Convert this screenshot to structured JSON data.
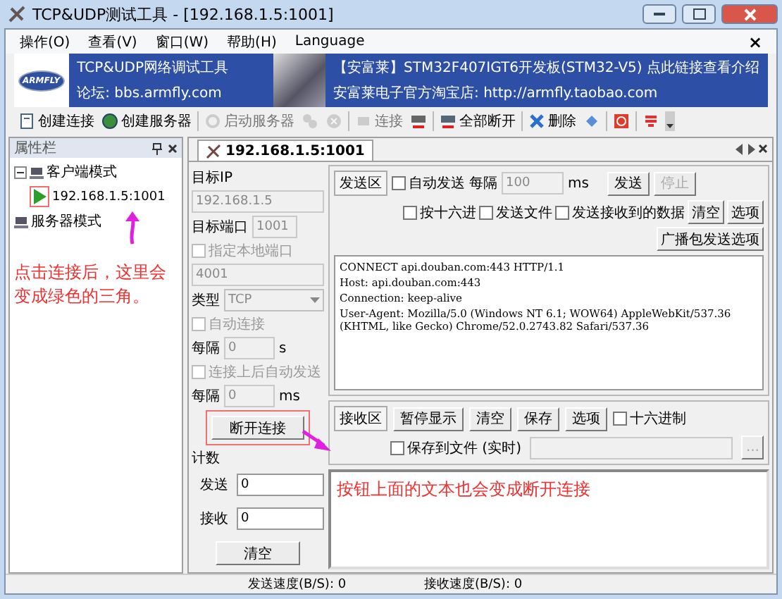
{
  "window": {
    "title": "TCP&UDP测试工具 - [192.168.1.5:1001]"
  },
  "menu": {
    "items": [
      "操作(O)",
      "查看(V)",
      "窗口(W)",
      "帮助(H)",
      "Language"
    ],
    "close": "×"
  },
  "banner": {
    "logo": "ARMFLY",
    "title": "TCP&UDP网络调试工具",
    "forum": "论坛: bbs.armfly.com",
    "product": "【安富莱】STM32F407IGT6开发板(STM32-V5) 点此链接查看介绍",
    "shop": "安富莱电子官方淘宝店: http://armfly.taobao.com"
  },
  "toolbar": [
    {
      "kind": "labeled",
      "label": "创建连接",
      "disabled": false
    },
    {
      "kind": "labeled",
      "label": "创建服务器",
      "disabled": false
    },
    {
      "kind": "separator"
    },
    {
      "kind": "labeled",
      "label": "启动服务器",
      "disabled": true
    },
    {
      "kind": "icon",
      "disabled": true
    },
    {
      "kind": "icon",
      "disabled": true
    },
    {
      "kind": "separator"
    },
    {
      "kind": "labeled",
      "label": "连接",
      "disabled": true
    },
    {
      "kind": "icon",
      "disabled": false
    },
    {
      "kind": "separator"
    },
    {
      "kind": "labeled",
      "label": "全部断开",
      "disabled": false
    },
    {
      "kind": "separator"
    },
    {
      "kind": "labeled",
      "label": "删除",
      "disabled": false
    },
    {
      "kind": "icon",
      "disabled": false
    },
    {
      "kind": "separator"
    },
    {
      "kind": "icon",
      "disabled": false
    },
    {
      "kind": "separator"
    },
    {
      "kind": "icon",
      "disabled": false
    }
  ],
  "sidebar": {
    "title": "属性栏",
    "tree": [
      {
        "label": "客户端模式",
        "expanded": true,
        "children": [
          {
            "label": "192.168.1.5:1001",
            "connected": true,
            "highlighted": true
          }
        ]
      },
      {
        "label": "服务器模式"
      }
    ],
    "note": "点击连接后，这里会变成绿色的三角。"
  },
  "tabs": [
    {
      "label": "192.168.1.5:1001",
      "selected": true
    }
  ],
  "config": {
    "ip_label": "目标IP",
    "ip": "192.168.1.5",
    "port_label": "目标端口",
    "port": "1001",
    "local_port": {
      "label": "指定本地端口",
      "checked": false
    },
    "local_port_value": "4001",
    "type_label": "类型",
    "type": "TCP",
    "auto_connect": {
      "label": "自动连接",
      "checked": false
    },
    "interval1": {
      "label": "每隔",
      "value": "0",
      "unit": "s"
    },
    "auto_send": {
      "label": "连接上后自动发送",
      "checked": false
    },
    "interval2": {
      "label": "每隔",
      "value": "0",
      "unit": "ms"
    },
    "connect_button": {
      "label": "断开连接",
      "highlighted": true
    }
  },
  "counter": {
    "title": "计数",
    "sent_label": "发送",
    "sent": "0",
    "received_label": "接收",
    "received": "0",
    "clear": "清空"
  },
  "send": {
    "title": "发送区",
    "auto_send": {
      "label": "自动发送",
      "checked": false
    },
    "interval_label": "每隔",
    "interval": "100",
    "unit": "ms",
    "send": {
      "label": "发送",
      "disabled": false
    },
    "stop": {
      "label": "停止",
      "disabled": true
    },
    "options": [
      {
        "label": "按十六进",
        "checked": false
      },
      {
        "label": "发送文件",
        "checked": false
      },
      {
        "label": "发送接收到的数据",
        "checked": false
      }
    ],
    "buttons": [
      "清空",
      "选项",
      "广播包发送选项"
    ],
    "lines": [
      "CONNECT api.douban.com:443 HTTP/1.1",
      "Host: api.douban.com:443",
      "Connection: keep-alive",
      "User-Agent: Mozilla/5.0 (Windows NT 6.1; WOW64) AppleWebKit/537.36 (KHTML, like Gecko) Chrome/52.0.2743.82 Safari/537.36"
    ]
  },
  "receive": {
    "title": "接收区",
    "buttons": [
      "暂停显示",
      "清空",
      "保存",
      "选项"
    ],
    "hex": {
      "label": "十六进制",
      "checked": false
    },
    "save_file": {
      "label": "保存到文件 (实时)",
      "checked": false
    },
    "browse": "...",
    "note": "按钮上面的文本也会变成断开连接"
  },
  "status_bar": [
    "发送速度(B/S): 0",
    "接收速度(B/S): 0"
  ]
}
